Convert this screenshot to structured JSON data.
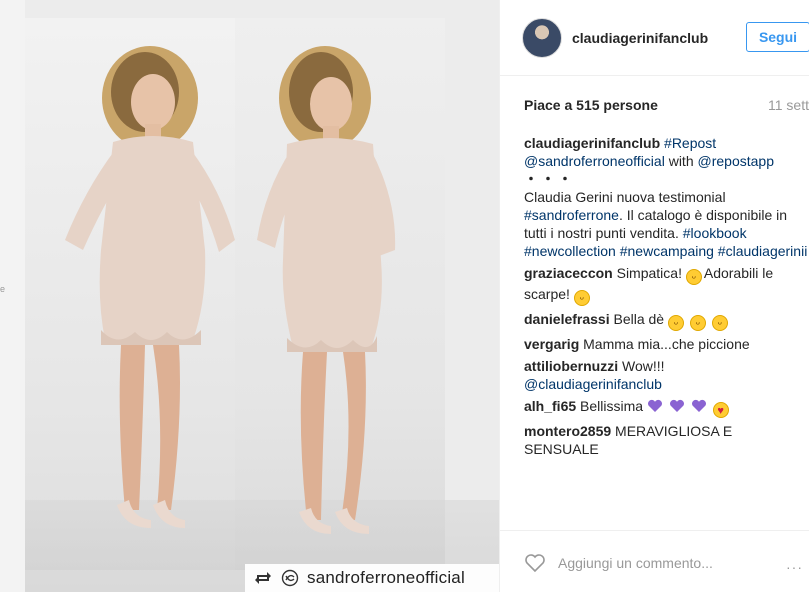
{
  "post": {
    "username": "claudiagerinifanclub",
    "follow_label": "Segui",
    "likes": "Piace a 515 persone",
    "time": "11 sett.",
    "repost_handle": "sandroferroneofficial",
    "add_comment_placeholder": "Aggiungi un commento...",
    "more_label": "···"
  },
  "caption": {
    "user": "claudiagerinifanclub",
    "repost_tag": "#Repost",
    "mention": "@sandroferroneofficial",
    "with": "with",
    "repostapp": "@repostapp",
    "dots": "・・・",
    "text": "Claudia Gerini nuova testimonial",
    "tag1": "#sandroferrone",
    "text2": ". Il catalogo è disponibile in tutti i nostri punti vendita.",
    "tag2": "#lookbook",
    "tag3": "#newcollection",
    "tag4": "#newcampaing",
    "tag5": "#claudiagerinii"
  },
  "comments": [
    {
      "user": "graziaceccon",
      "text": "Simpatica!",
      "text2": "Adorabili le scarpe!"
    },
    {
      "user": "danielefrassi",
      "text": "Bella dè"
    },
    {
      "user": "vergarig",
      "text": "Mamma mia...che piccione"
    },
    {
      "user": "attiliobernuzzi",
      "text": "Wow!!!",
      "mention": "@claudiagerinifanclub"
    },
    {
      "user": "alh_fi65",
      "text": "Bellissima"
    },
    {
      "user": "montero2859",
      "text": "MERAVIGLIOSA E SENSUALE"
    }
  ],
  "colors": {
    "accent": "#3897f0",
    "link": "#003569",
    "heart_purple": "#8a63d2"
  }
}
